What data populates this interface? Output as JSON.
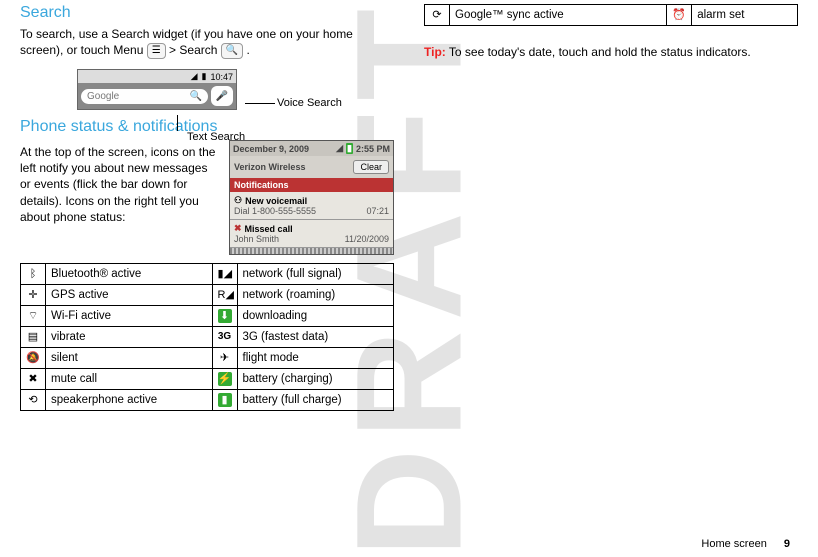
{
  "watermark": "DRAFT",
  "left": {
    "search_heading": "Search",
    "search_para_a": "To search, use a Search widget (if you have one on your home screen), or touch Menu ",
    "menu_key": "☰",
    "search_para_b": " > Search ",
    "search_key": "🔍",
    "search_para_c": ".",
    "searchfig": {
      "time": "10:47",
      "placeholder": "Google",
      "voice_label": "Voice Search",
      "text_label": "Text Search"
    },
    "status_heading": "Phone status & notifications",
    "status_para": "At the top of the screen, icons on the left notify you about new messages or events (flick the bar down for details). Icons on the right tell you about phone status:",
    "notif": {
      "date": "December 9, 2009",
      "time": "2:55 PM",
      "carrier": "Verizon Wireless",
      "clear": "Clear",
      "header": "Notifications",
      "vm_title": "New voicemail",
      "vm_sub": "Dial 1-800-555-5555",
      "vm_time": "07:21",
      "mc_title": "Missed call",
      "mc_sub": "John Smith",
      "mc_time": "11/20/2009"
    },
    "table": [
      {
        "li": "ᛒ",
        "lt": "Bluetooth® active",
        "ri": "▮◢",
        "rt": "network (full signal)"
      },
      {
        "li": "✛",
        "lt": "GPS active",
        "ri": "R◢",
        "rt": "network (roaming)"
      },
      {
        "li": "⌔",
        "lt": "Wi-Fi active",
        "ri": "⬇",
        "rt": "downloading",
        "ribadge": true
      },
      {
        "li": "▤",
        "lt": "vibrate",
        "ri": "3G",
        "rt": "3G (fastest data)",
        "ribold": true
      },
      {
        "li": "🔕",
        "lt": "silent",
        "ri": "✈",
        "rt": "flight mode"
      },
      {
        "li": "✖",
        "lt": "mute call",
        "ri": "⚡",
        "rt": "battery (charging)",
        "ribadge": true
      },
      {
        "li": "⟲",
        "lt": "speakerphone active",
        "ri": "▮",
        "rt": "battery (full charge)",
        "ribadge": true
      }
    ]
  },
  "right": {
    "table": [
      {
        "li": "⟳",
        "lt": "Google™ sync active",
        "ri": "⏰",
        "rt": "alarm set"
      }
    ],
    "tip_label": "Tip:",
    "tip_text": " To see today's date, touch and hold the status indicators."
  },
  "footer": {
    "section": "Home screen",
    "page": "9"
  }
}
